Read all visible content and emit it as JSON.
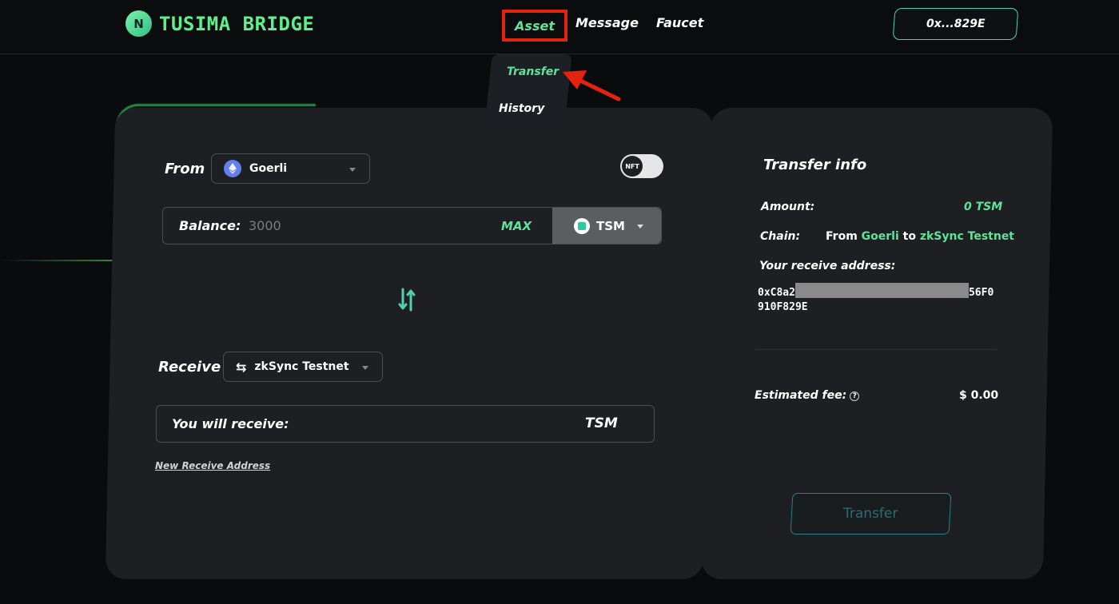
{
  "header": {
    "brand": "TUSIMA BRIDGE",
    "nav": {
      "asset": "Asset",
      "message": "Message",
      "faucet": "Faucet"
    },
    "wallet_address": "0x...829E"
  },
  "asset_menu": {
    "transfer": "Transfer",
    "history": "History"
  },
  "form": {
    "from_label": "From",
    "from_network": "Goerli",
    "nft_toggle": "NFT",
    "balance_label": "Balance:",
    "balance_value": "3000",
    "max_label": "MAX",
    "token": "TSM",
    "receive_label": "Receive",
    "receive_network": "zkSync Testnet",
    "you_will_receive_label": "You will receive:",
    "receive_token": "TSM",
    "new_receive_address": "New Receive Address"
  },
  "info": {
    "title": "Transfer info",
    "amount_label": "Amount:",
    "amount_value": "0 TSM",
    "chain_label": "Chain:",
    "chain_from_prefix": "From",
    "chain_from": "Goerli",
    "chain_to_word": "to",
    "chain_to": "zkSync Testnet",
    "receive_address_label": "Your receive address:",
    "address_start": "0xC8a2",
    "address_end_line1": "56F0",
    "address_line2": "910F829E",
    "estimated_fee_label": "Estimated fee:",
    "estimated_fee_value": "$ 0.00",
    "transfer_button": "Transfer"
  },
  "colors": {
    "accent_green": "#5fe39a",
    "annotation_red": "#e4230f",
    "panel": "#1d1f23"
  }
}
